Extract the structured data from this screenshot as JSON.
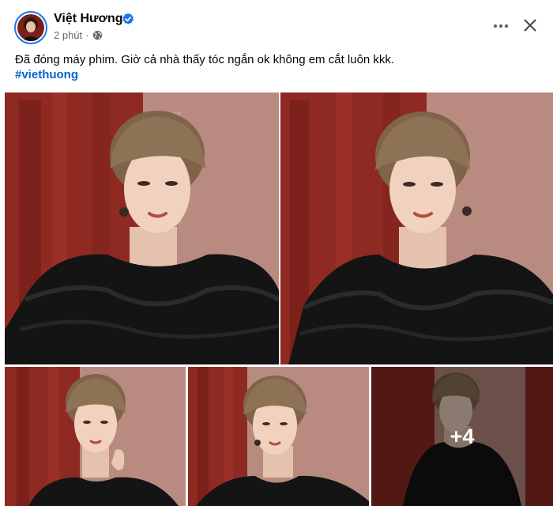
{
  "post": {
    "author": "Việt Hương",
    "time": "2 phút",
    "separator": "·",
    "caption": "Đã đóng máy phim. Giờ cả nhà thấy tóc ngắn ok không em cắt luôn kkk.",
    "hashtag": "#viethuong"
  },
  "header_actions": {
    "more_icon": "more-horizontal-icon",
    "close_icon": "close-icon"
  },
  "gallery": {
    "remaining_label": "+4"
  },
  "colors": {
    "link": "#0064d1",
    "verified": "#1877f2",
    "secondary_text": "#65676b"
  }
}
